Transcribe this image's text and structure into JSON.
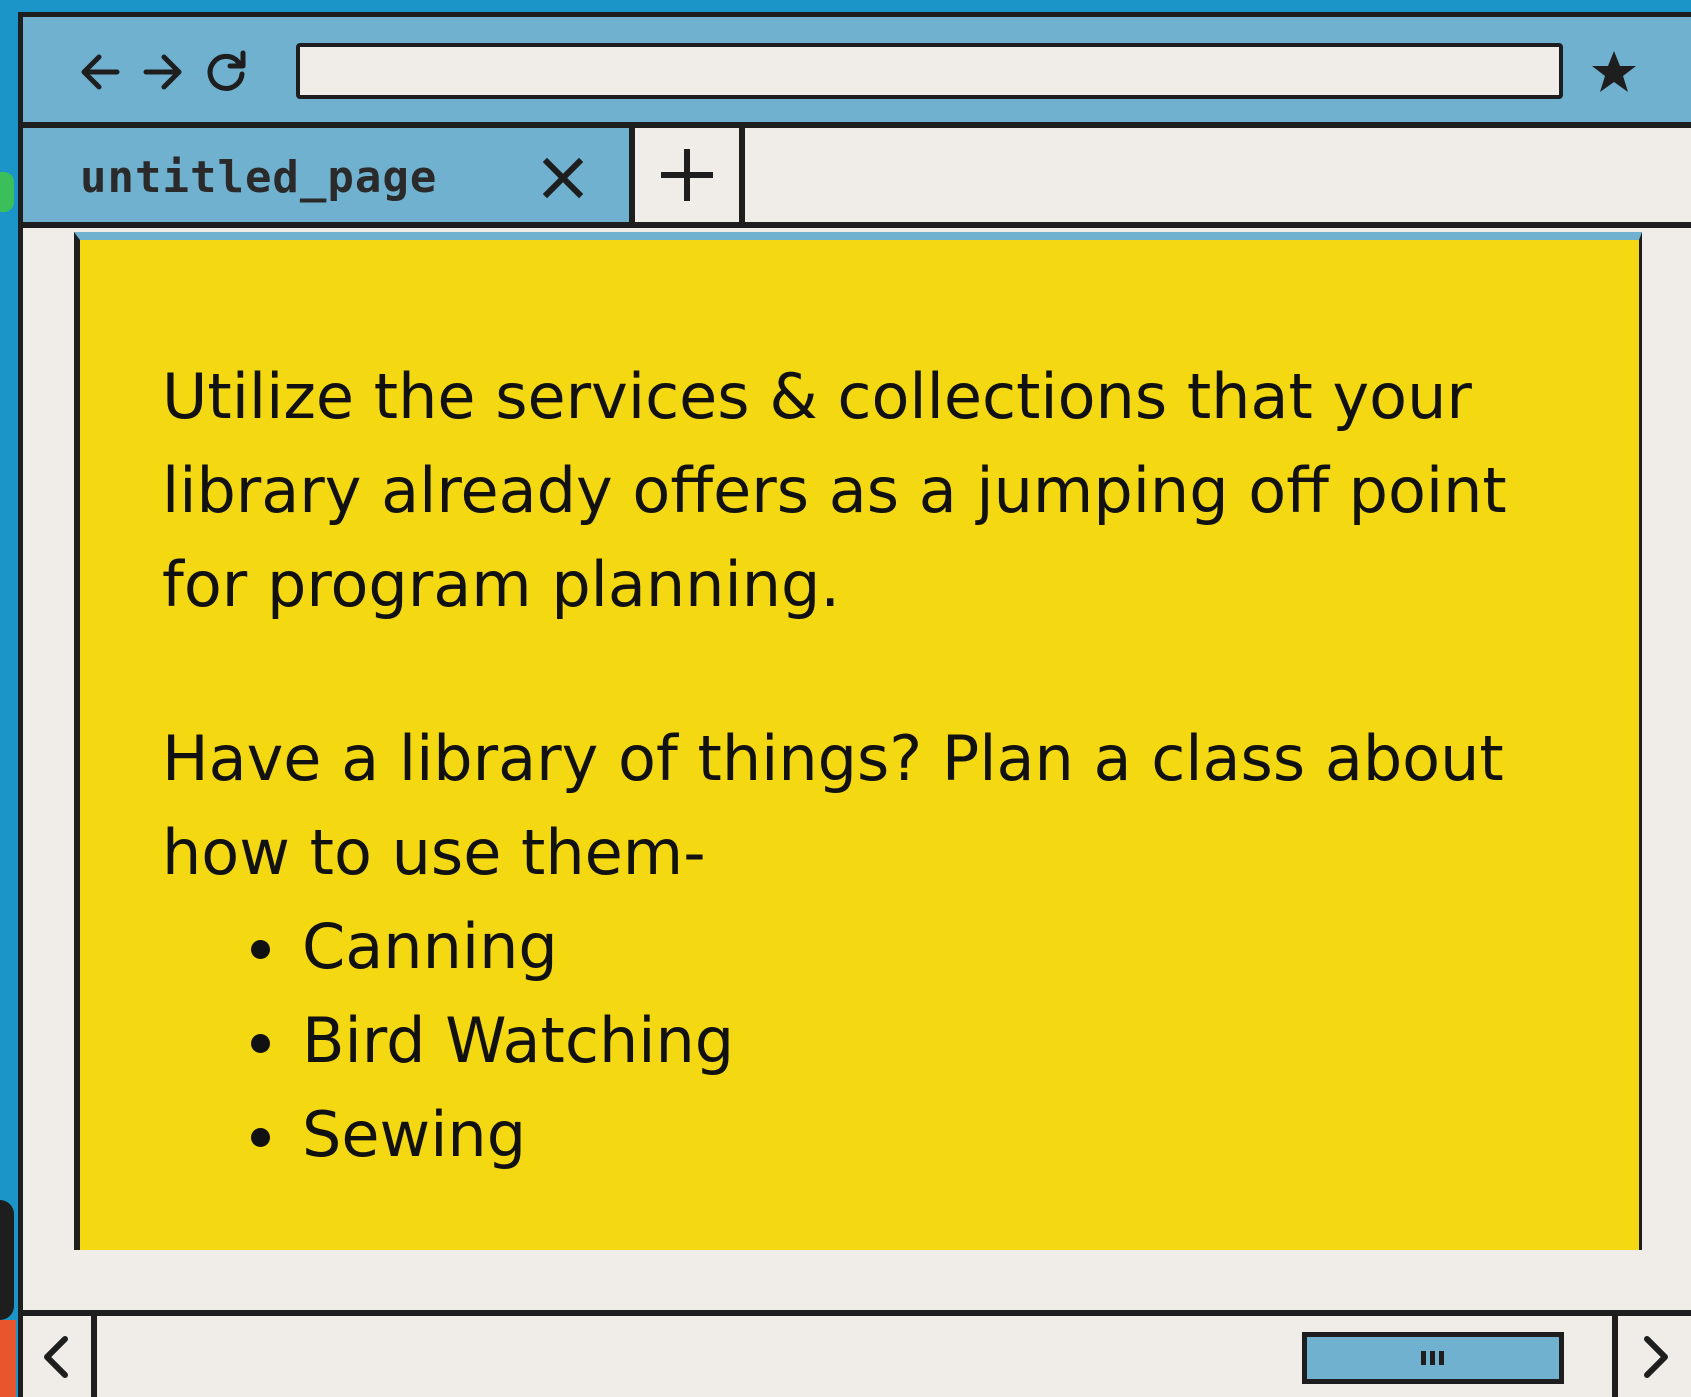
{
  "browser": {
    "address_bar": {
      "value": "",
      "placeholder": ""
    },
    "tabs": [
      {
        "title": "untitled_page",
        "active": true
      }
    ]
  },
  "page": {
    "paragraphs": [
      "Utilize the services & collections that your library already offers as a jumping off point for program planning.",
      "Have a library of things? Plan a class about how to use them-"
    ],
    "list_items": [
      "Canning",
      "Bird Watching",
      "Sewing"
    ]
  },
  "icons": {
    "back": "arrow-left-icon",
    "forward": "arrow-right-icon",
    "reload": "reload-icon",
    "bookmark": "star-icon",
    "close_tab": "close-icon",
    "new_tab": "plus-icon",
    "scroll_left": "chevron-left-icon",
    "scroll_right": "chevron-right-icon",
    "scroll_thumb": "grip-icon"
  },
  "colors": {
    "chrome_blue": "#6fb1cf",
    "backdrop_blue": "#1b95c8",
    "content_yellow": "#f4d812",
    "frame_dark": "#1e1e1e",
    "background_cream": "#f0ede8"
  }
}
